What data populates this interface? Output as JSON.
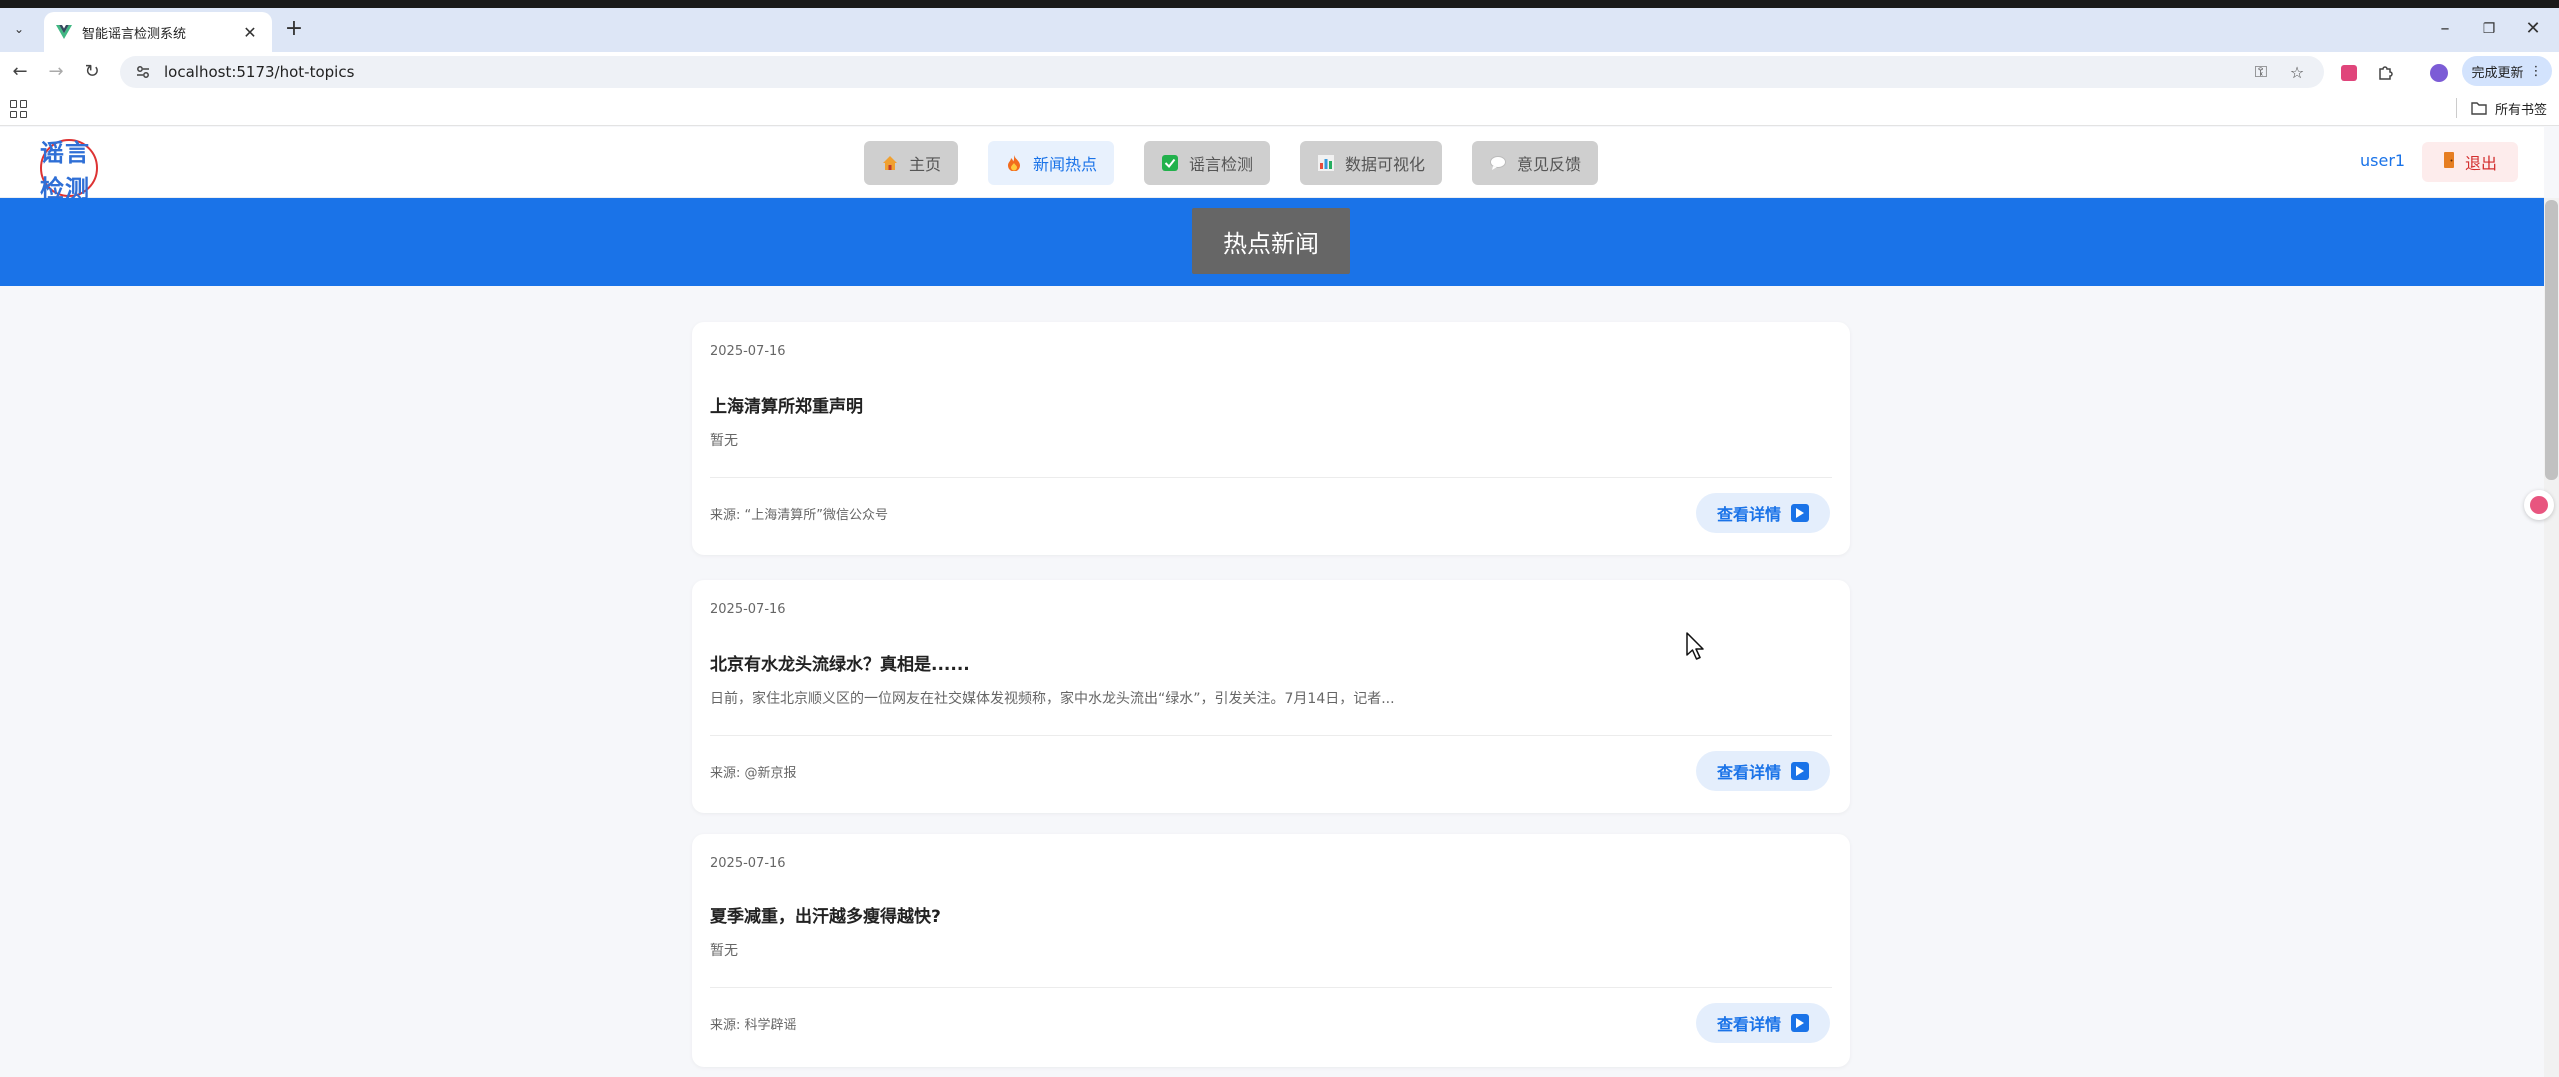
{
  "browser": {
    "tab_title": "智能谣言检测系统",
    "url": "localhost:5173/hot-topics",
    "update_label": "完成更新",
    "bookmarks_label": "所有书签"
  },
  "header": {
    "logo_line1": "谣言",
    "logo_line2": "检测",
    "nav": [
      {
        "label": "主页",
        "icon": "home-icon",
        "active": false
      },
      {
        "label": "新闻热点",
        "icon": "fire-icon",
        "active": true
      },
      {
        "label": "谣言检测",
        "icon": "check-icon",
        "active": false
      },
      {
        "label": "数据可视化",
        "icon": "chart-icon",
        "active": false
      },
      {
        "label": "意见反馈",
        "icon": "chat-icon",
        "active": false
      }
    ],
    "username": "user1",
    "logout_label": "退出"
  },
  "banner": {
    "title": "热点新闻"
  },
  "news": [
    {
      "date": "2025-07-16",
      "title": "上海清算所郑重声明",
      "summary": "暂无",
      "source": "来源: “上海清算所”微信公众号",
      "detail_label": "查看详情"
    },
    {
      "date": "2025-07-16",
      "title": "北京有水龙头流绿水？真相是......",
      "summary": "日前，家住北京顺义区的一位网友在社交媒体发视频称，家中水龙头流出“绿水”，引发关注。7月14日，记者...",
      "source": "来源: @新京报",
      "detail_label": "查看详情"
    },
    {
      "date": "2025-07-16",
      "title": "夏季减重，出汗越多瘦得越快?",
      "summary": "暂无",
      "source": "来源: 科学辟谣",
      "detail_label": "查看详情"
    }
  ],
  "colors": {
    "primary": "#1a73e8",
    "banner_bg": "#1a73e8",
    "logout_text": "#d32f2f"
  }
}
